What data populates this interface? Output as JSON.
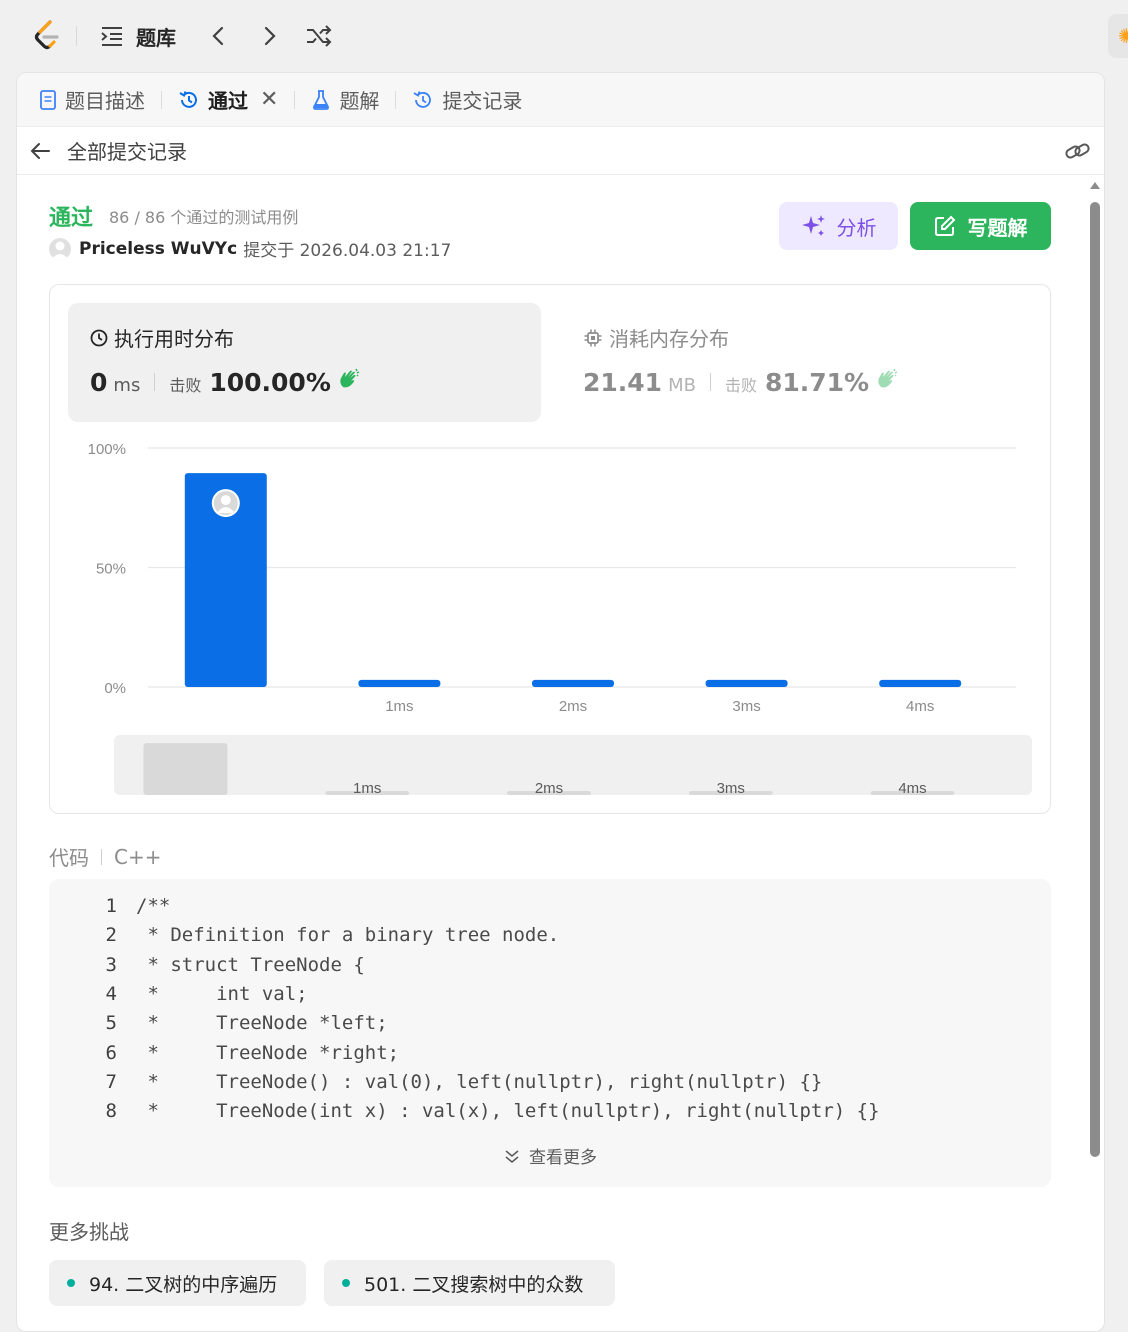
{
  "topbar": {
    "problem_list_label": "题库"
  },
  "tabs": [
    {
      "label": "题目描述",
      "icon": "description-icon"
    },
    {
      "label": "通过",
      "icon": "history-icon",
      "active": true
    },
    {
      "label": "题解",
      "icon": "flask-icon"
    },
    {
      "label": "提交记录",
      "icon": "history-icon"
    }
  ],
  "subheader": {
    "back_label": "全部提交记录"
  },
  "submission": {
    "status": "通过",
    "testcases": "86 / 86 个通过的测试用例",
    "author": "Priceless WuVYc",
    "submitted_at": "提交于 2026.04.03 21:17",
    "analyze_label": "分析",
    "write_solution_label": "写题解"
  },
  "runtime": {
    "title": "执行用时分布",
    "value": "0",
    "unit": "ms",
    "beat_label": "击败",
    "beat_pct": "100.00%"
  },
  "memory": {
    "title": "消耗内存分布",
    "value": "21.41",
    "unit": "MB",
    "beat_label": "击败",
    "beat_pct": "81.71%"
  },
  "chart_data": {
    "type": "bar",
    "categories": [
      "0ms",
      "1ms",
      "2ms",
      "3ms",
      "4ms"
    ],
    "category_labels": [
      "",
      "1ms",
      "2ms",
      "3ms",
      "4ms"
    ],
    "values": [
      89.5,
      3,
      3,
      3,
      3
    ],
    "ylim": [
      0,
      100
    ],
    "y_ticks": [
      "0%",
      "50%",
      "100%"
    ],
    "grid": true,
    "bar_color": "#0a6fe6",
    "highlight_index": 0
  },
  "code": {
    "label": "代码",
    "language": "C++",
    "lines": [
      {
        "n": "1",
        "text": "/**"
      },
      {
        "n": "2",
        "text": " * Definition for a binary tree node."
      },
      {
        "n": "3",
        "text": " * struct TreeNode {"
      },
      {
        "n": "4",
        "text": " *     int val;"
      },
      {
        "n": "5",
        "text": " *     TreeNode *left;"
      },
      {
        "n": "6",
        "text": " *     TreeNode *right;"
      },
      {
        "n": "7",
        "text": " *     TreeNode() : val(0), left(nullptr), right(nullptr) {}"
      },
      {
        "n": "8",
        "text": " *     TreeNode(int x) : val(x), left(nullptr), right(nullptr) {}"
      }
    ],
    "more_label": "查看更多"
  },
  "challenges": {
    "title": "更多挑战",
    "items": [
      "94. 二叉树的中序遍历",
      "501. 二叉搜索树中的众数"
    ]
  },
  "colors": {
    "accent_green": "#2db55d",
    "analyze_purple": "#7b4fe8",
    "chart_blue": "#0a6fe6",
    "difficulty_easy": "#00af9b"
  }
}
